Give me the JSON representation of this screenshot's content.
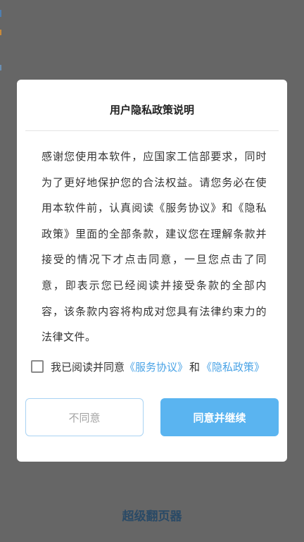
{
  "dialog": {
    "title": "用户隐私政策说明",
    "body": "感谢您使用本软件，应国家工信部要求，同时为了更好地保护您的合法权益。请您务必在使用本软件前，认真阅读《服务协议》和《隐私政策》里面的全部条款，建议您在理解条款并接受的情况下才点击同意，一旦您点击了同意，即表示您已经阅读并接受条款的全部内容，该条款内容将构成对您具有法律约束力的法律文件。",
    "agree_checkbox": {
      "checked": false,
      "prefix": "我已阅读并同意",
      "service_link": "《服务协议》",
      "and": "和",
      "privacy_link": "《隐私政策》"
    },
    "disagree_label": "不同意",
    "agree_label": "同意并继续"
  },
  "background": {
    "app_name": "超级翻页器"
  },
  "colors": {
    "overlay": "#666666",
    "link": "#4aa3e6",
    "primary_button": "#5ab4f0",
    "secondary_button_border": "#a9d3f3",
    "app_name": "#2a4a66"
  }
}
